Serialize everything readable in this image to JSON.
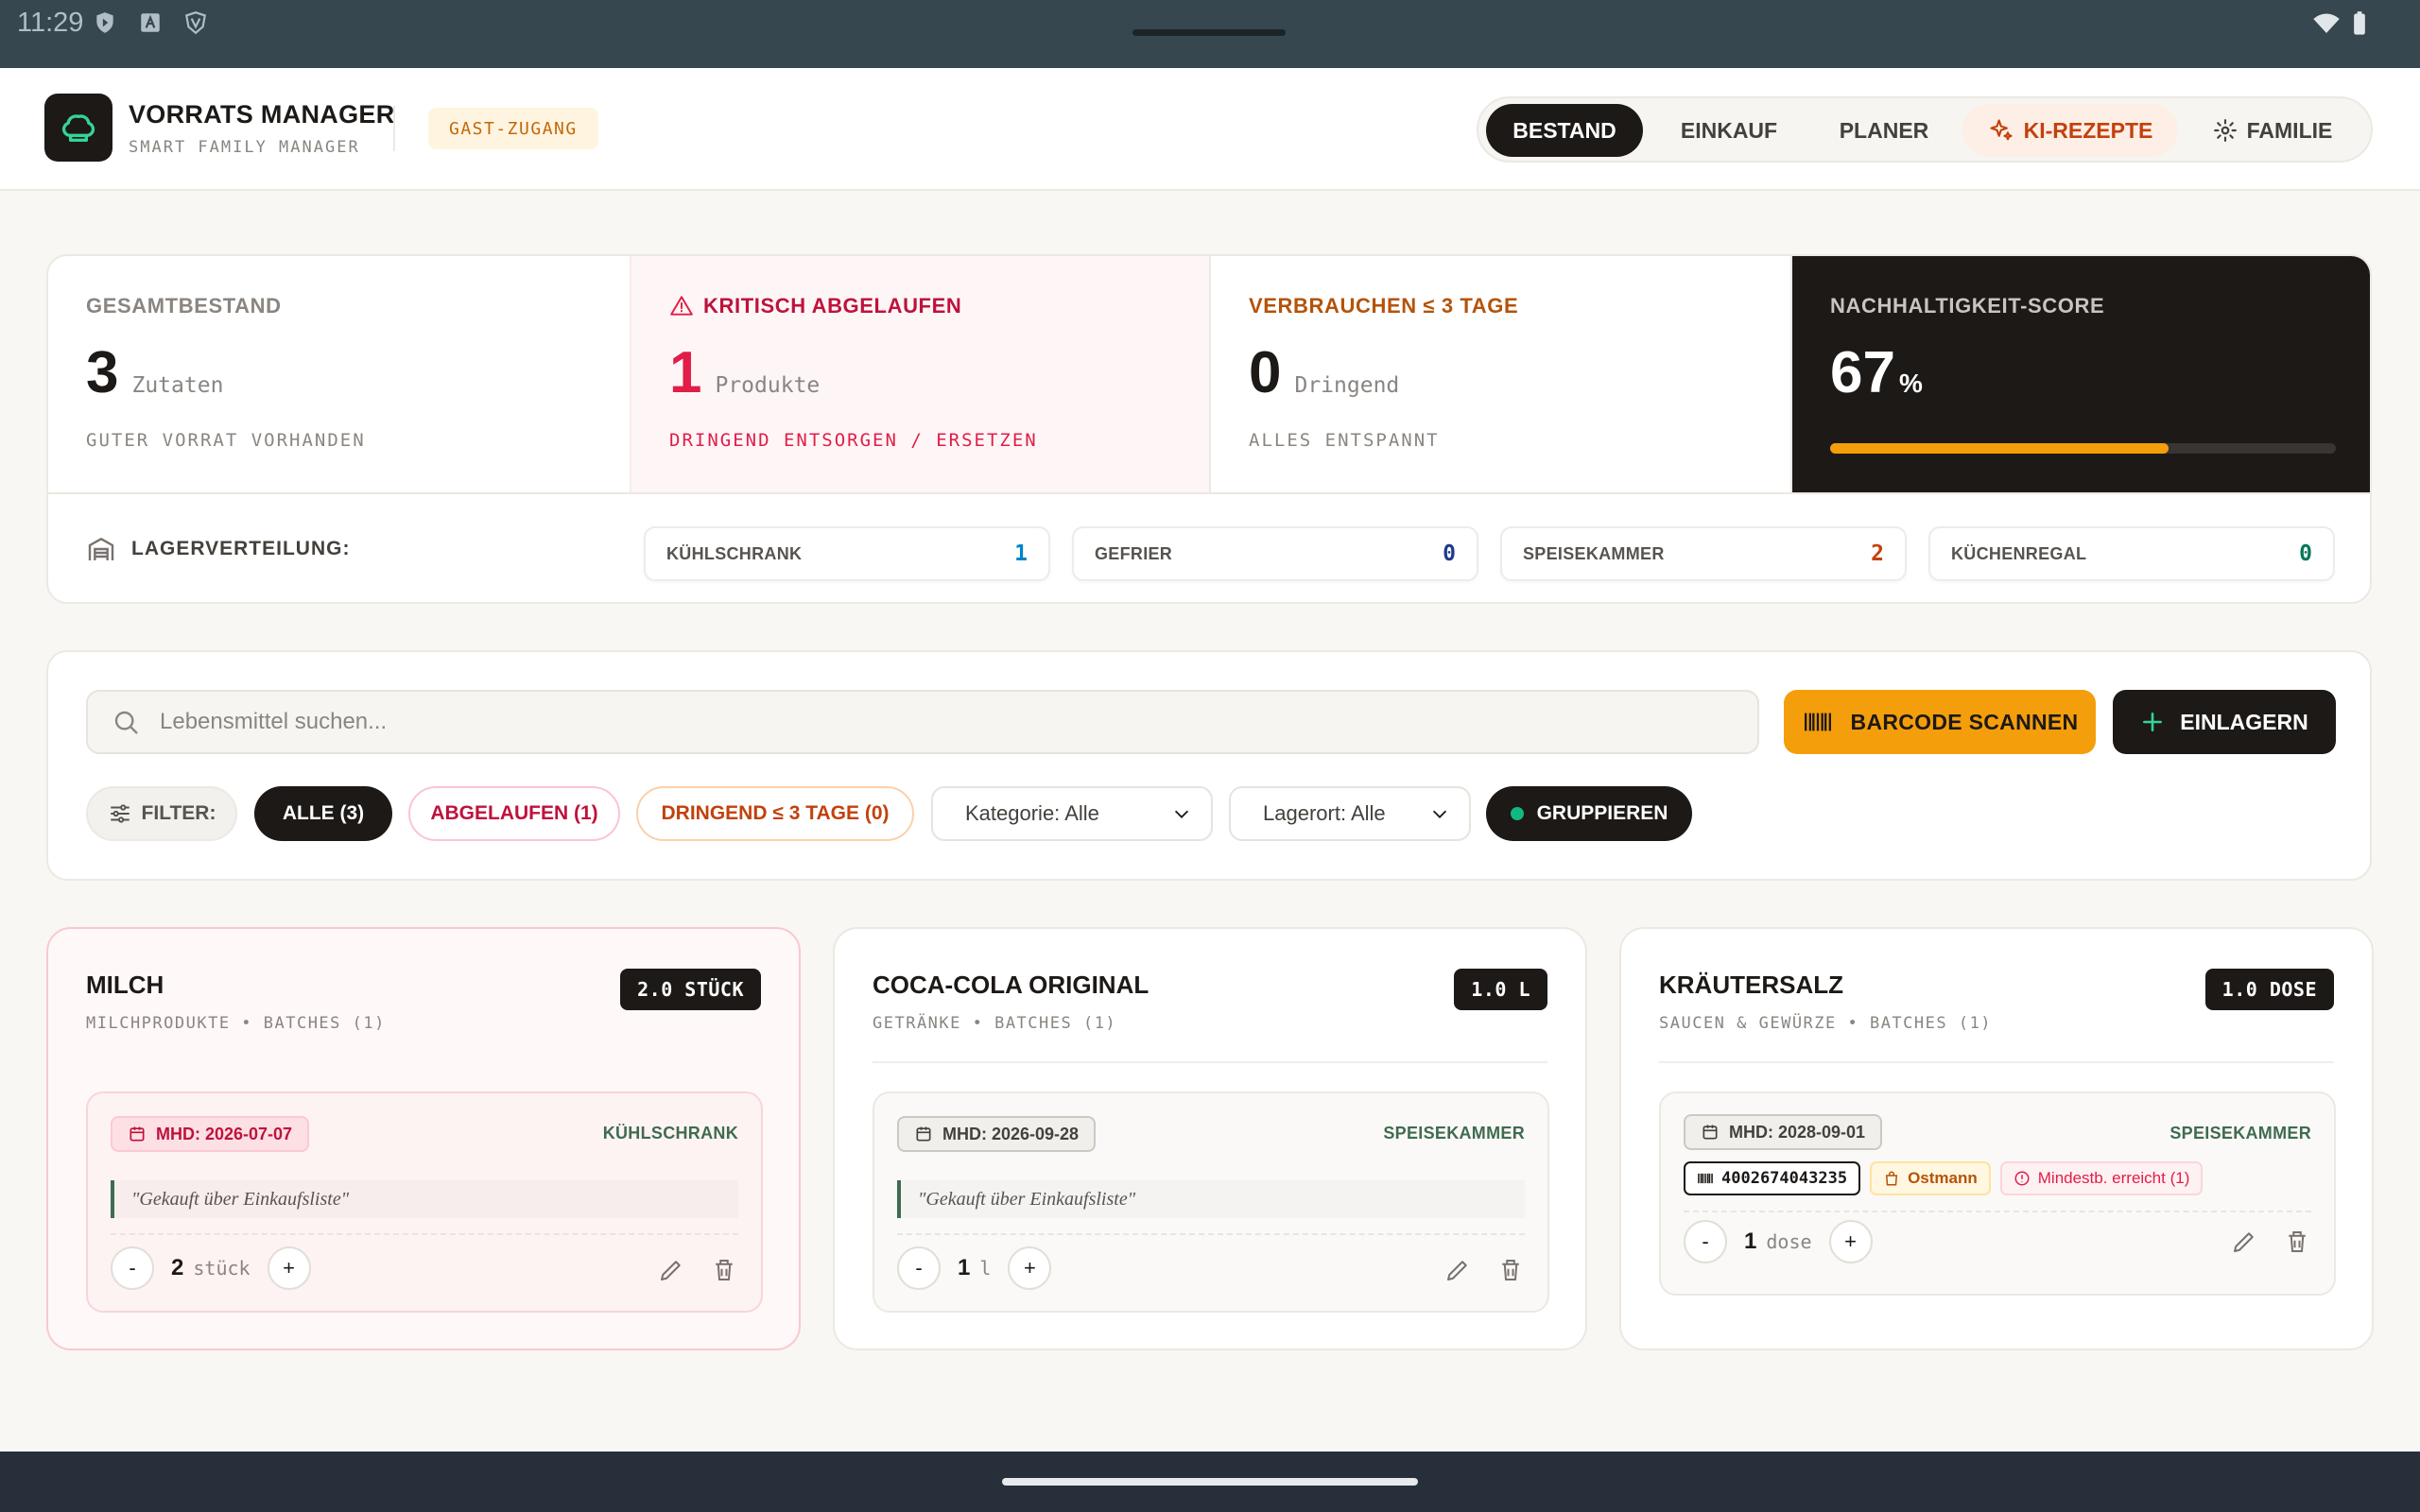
{
  "status_bar": {
    "time": "11:29"
  },
  "app": {
    "title": "VORRATS MANAGER",
    "subtitle": "SMART FAMILY MANAGER",
    "guest_badge": "GAST-ZUGANG"
  },
  "nav": {
    "items": [
      {
        "label": "BESTAND",
        "active": true
      },
      {
        "label": "EINKAUF"
      },
      {
        "label": "PLANER"
      },
      {
        "label": "KI-REZEPTE"
      },
      {
        "label": "FAMILIE"
      }
    ]
  },
  "stats": {
    "total": {
      "label": "GESAMTBESTAND",
      "value": "3",
      "unit": "Zutaten",
      "foot": "GUTER VORRAT VORHANDEN"
    },
    "critical": {
      "label": "KRITISCH ABGELAUFEN",
      "value": "1",
      "unit": "Produkte",
      "foot": "DRINGEND ENTSORGEN / ERSETZEN"
    },
    "urgent": {
      "label": "VERBRAUCHEN ≤ 3 TAGE",
      "value": "0",
      "unit": "Dringend",
      "foot": "ALLES ENTSPANNT"
    },
    "score": {
      "label": "NACHHALTIGKEIT-SCORE",
      "value": "67",
      "unit": "%",
      "progress_percent": 67
    }
  },
  "storage": {
    "label": "LAGERVERTEILUNG:",
    "locations": [
      {
        "name": "KÜHLSCHRANK",
        "count": "1",
        "color": "#0284c7"
      },
      {
        "name": "GEFRIER",
        "count": "0",
        "color": "#1e3a8a"
      },
      {
        "name": "SPEISEKAMMER",
        "count": "2",
        "color": "#c2410c"
      },
      {
        "name": "KÜCHENREGAL",
        "count": "0",
        "color": "#047857"
      }
    ]
  },
  "search": {
    "placeholder": "Lebensmittel suchen..."
  },
  "actions": {
    "scan": "BARCODE SCANNEN",
    "add": "EINLAGERN"
  },
  "filters": {
    "label": "FILTER:",
    "all": "ALLE (3)",
    "expired": "ABGELAUFEN (1)",
    "urgent": "DRINGEND ≤ 3 TAGE (0)",
    "category": "Kategorie: Alle",
    "location": "Lagerort: Alle",
    "group": "GRUPPIEREN"
  },
  "items": [
    {
      "name": "MILCH",
      "meta": "MILCHPRODUKTE • BATCHES (1)",
      "qty_badge": "2.0 STÜCK",
      "mhd": "MHD: 2026-07-07",
      "place": "KÜHLSCHRANK",
      "note": "\"Gekauft über Einkaufsliste\"",
      "count": "2",
      "unit": "stück"
    },
    {
      "name": "COCA-COLA ORIGINAL",
      "meta": "GETRÄNKE • BATCHES (1)",
      "qty_badge": "1.0 L",
      "mhd": "MHD: 2026-09-28",
      "place": "SPEISEKAMMER",
      "note": "\"Gekauft über Einkaufsliste\"",
      "count": "1",
      "unit": "l"
    },
    {
      "name": "KRÄUTERSALZ",
      "meta": "SAUCEN & GEWÜRZE • BATCHES (1)",
      "qty_badge": "1.0 DOSE",
      "mhd": "MHD: 2028-09-01",
      "place": "SPEISEKAMMER",
      "barcode": "4002674043235",
      "brand": "Ostmann",
      "min_reached": "Mindestb. erreicht (1)",
      "count": "1",
      "unit": "dose"
    }
  ],
  "stepper": {
    "minus": "-",
    "plus": "+"
  },
  "colors": {
    "accent": "#f59e0b",
    "dark": "#1c1917",
    "critical": "#be123c",
    "urgent": "#c2410c",
    "ok": "#3f6b50"
  }
}
